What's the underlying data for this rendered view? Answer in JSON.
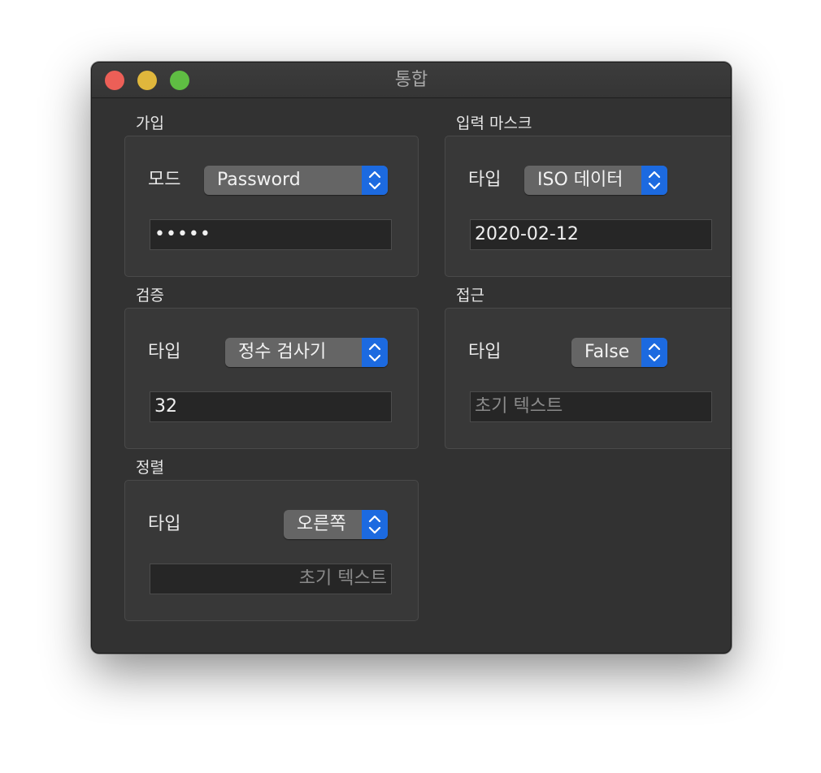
{
  "window": {
    "title": "통합"
  },
  "groups": {
    "signup": {
      "label": "가입",
      "row_label": "모드",
      "popup_value": "Password",
      "field_value": "•••••"
    },
    "input_mask": {
      "label": "입력 마스크",
      "row_label": "타입",
      "popup_value": "ISO 데이터",
      "field_value": "2020-02-12"
    },
    "validation": {
      "label": "검증",
      "row_label": "타입",
      "popup_value": "정수 검사기",
      "field_value": "32"
    },
    "access": {
      "label": "접근",
      "row_label": "타입",
      "popup_value": "False",
      "field_placeholder": "초기 텍스트"
    },
    "alignment": {
      "label": "정렬",
      "row_label": "타입",
      "popup_value": "오른쪽",
      "field_placeholder": "초기 텍스트"
    }
  },
  "colors": {
    "window_bg": "#323232",
    "accent": "#1c6ae0",
    "close": "#ec5f57",
    "minimize": "#e0b73c",
    "maximize": "#5fbd43"
  }
}
